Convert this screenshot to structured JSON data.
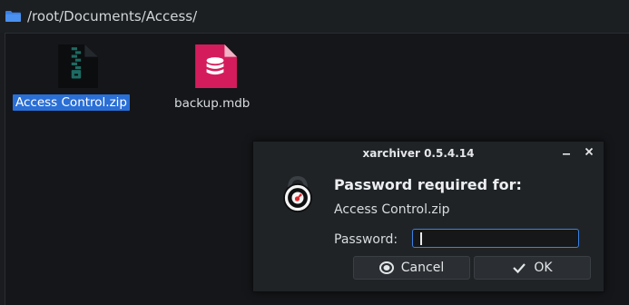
{
  "pathbar": {
    "path": "/root/Documents/Access/",
    "icon": "folder-icon"
  },
  "files": [
    {
      "name": "Access Control.zip",
      "icon": "zip-archive-icon",
      "selected": true
    },
    {
      "name": "backup.mdb",
      "icon": "database-file-icon",
      "selected": false
    }
  ],
  "dialog": {
    "title": "xarchiver 0.5.4.14",
    "heading": "Password required for:",
    "filename": "Access Control.zip",
    "password_label": "Password:",
    "password_value": "",
    "cancel_label": "Cancel",
    "ok_label": "OK"
  },
  "colors": {
    "accent": "#2a6fd6",
    "database_icon": "#d41c5c",
    "background": "#141619",
    "dialog_bg": "#202326"
  }
}
